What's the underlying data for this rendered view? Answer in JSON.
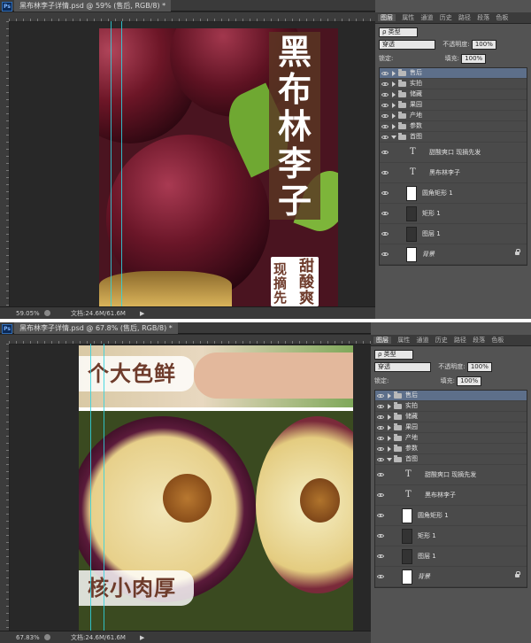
{
  "top_window": {
    "title": "黑布林李子详情.psd @ 59% (售后, RGB/8) *",
    "zoom": "59.05%",
    "doc_info": "文档:24.6M/61.6M",
    "poster": {
      "vertical_title": [
        "黑",
        "布",
        "林",
        "李",
        "子"
      ],
      "slogan_col1": [
        "甜",
        "酸",
        "爽"
      ],
      "slogan_col2": [
        "现",
        "摘",
        "先"
      ]
    }
  },
  "bottom_window": {
    "title": "黑布林李子详情.psd @ 67.8% (售后, RGB/8) *",
    "zoom": "67.83%",
    "doc_info": "文档:24.6M/61.6M",
    "poster": {
      "label_top": "个大色鲜",
      "label_bottom": "核小肉厚"
    }
  },
  "panel": {
    "tabs": [
      "图层",
      "属性",
      "通道",
      "历史",
      "路径",
      "段落",
      "色板"
    ],
    "kind_filter": "ρ 类型",
    "blend_mode": "穿透",
    "opacity_label": "不透明度:",
    "opacity_value": "100%",
    "lock_label": "锁定:",
    "fill_label": "填充:",
    "fill_value": "100%",
    "layers": [
      {
        "name": "售后",
        "type": "group",
        "open": false,
        "selected": true
      },
      {
        "name": "实拍",
        "type": "group",
        "open": false
      },
      {
        "name": "储藏",
        "type": "group",
        "open": false
      },
      {
        "name": "果园",
        "type": "group",
        "open": false
      },
      {
        "name": "产地",
        "type": "group",
        "open": false
      },
      {
        "name": "参数",
        "type": "group",
        "open": false
      },
      {
        "name": "首图",
        "type": "group",
        "open": true
      },
      {
        "name": "甜酸爽口  现摘先发",
        "type": "text"
      },
      {
        "name": "黑布林李子",
        "type": "text"
      },
      {
        "name": "圆角矩形 1",
        "type": "shape"
      },
      {
        "name": "矩形 1",
        "type": "shape"
      },
      {
        "name": "图层 1",
        "type": "pixel"
      },
      {
        "name": "背景",
        "type": "background",
        "locked": true
      }
    ]
  }
}
